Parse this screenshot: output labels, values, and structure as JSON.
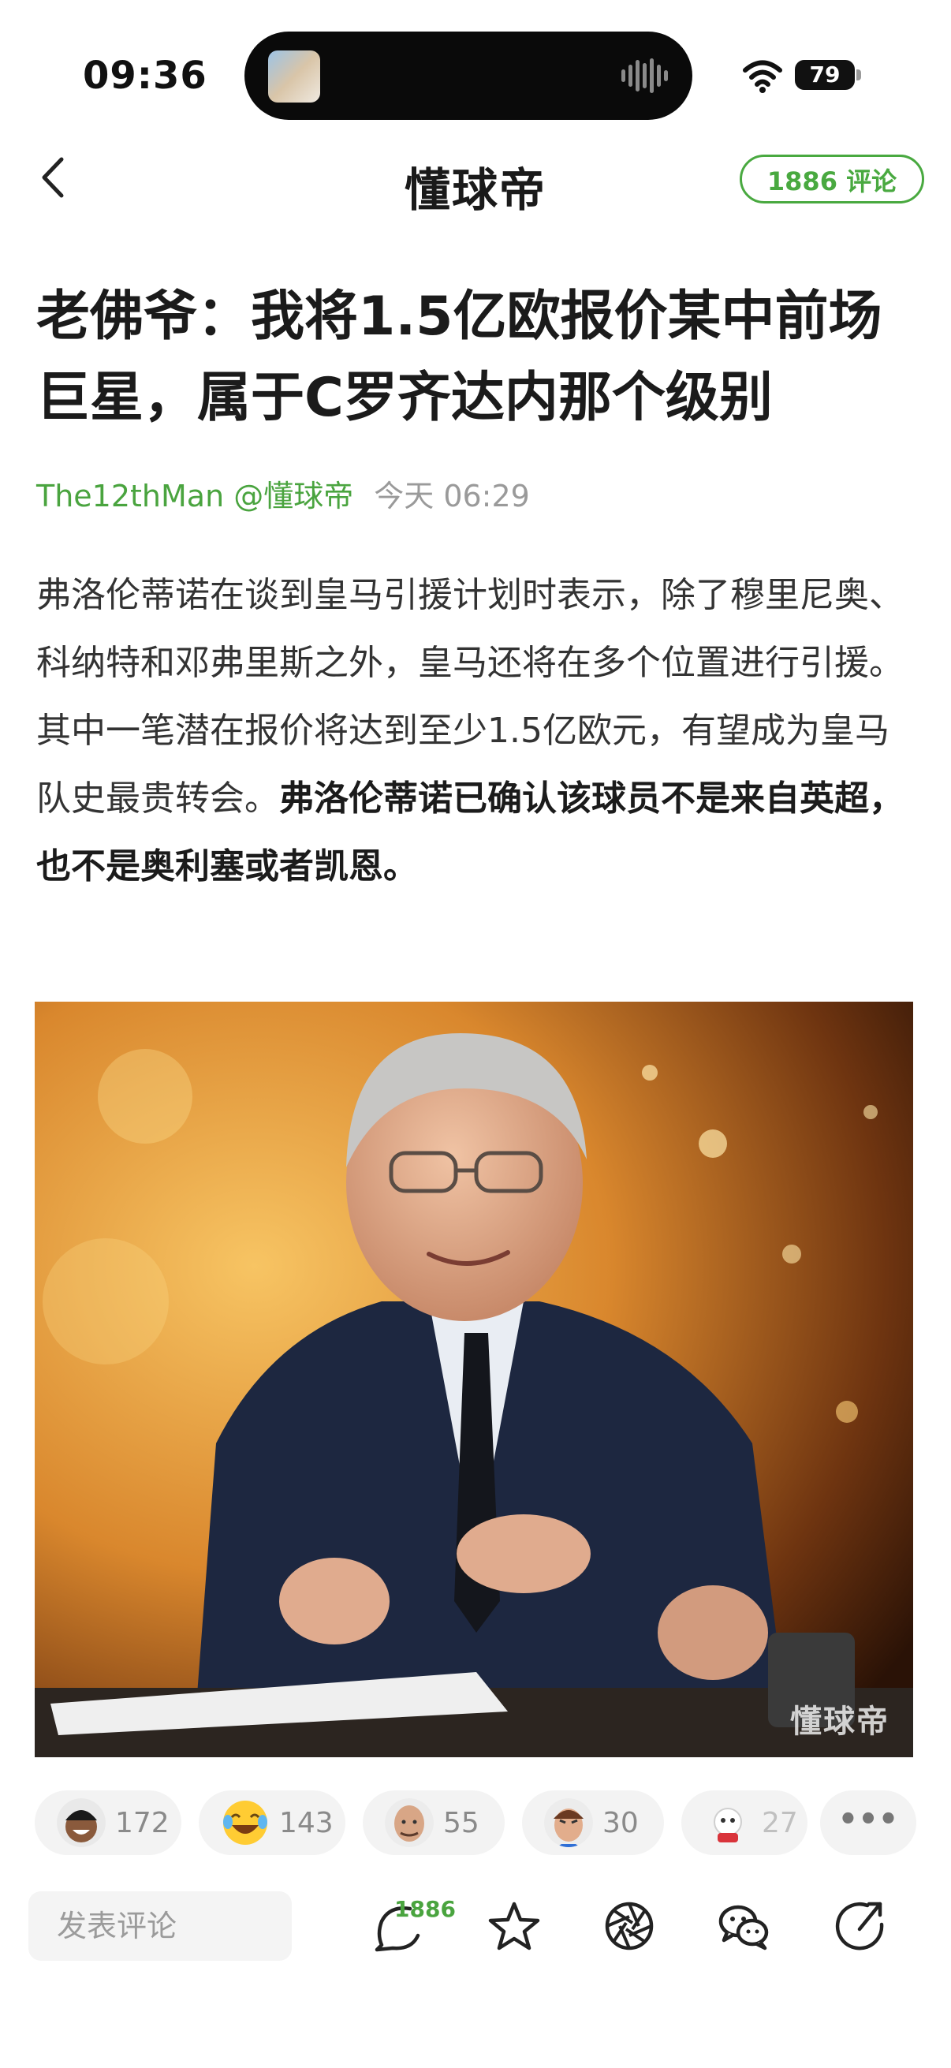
{
  "status_bar": {
    "time": "09:36",
    "battery": "79"
  },
  "nav": {
    "logo": "懂球帝",
    "comments_button": "1886 评论"
  },
  "article": {
    "title": "老佛爷：我将1.5亿欧报价某中前场巨星，属于C罗齐达内那个级别",
    "author": "The12thMan @懂球帝",
    "date": "今天 06:29",
    "body_normal": "弗洛伦蒂诺在谈到皇马引援计划时表示，除了穆里尼奥、科纳特和邓弗里斯之外，皇马还将在多个位置进行引援。其中一笔潜在报价将达到至少1.5亿欧元，有望成为皇马队史最贵转会。",
    "body_bold": "弗洛伦蒂诺已确认该球员不是来自英超，也不是奥利塞或者凯恩。",
    "image_watermark": "懂球帝"
  },
  "reactions": [
    {
      "icon": "laughing-avatar-icon",
      "count": "172"
    },
    {
      "icon": "tears-of-joy-emoji-icon",
      "count": "143"
    },
    {
      "icon": "bald-man-avatar-icon",
      "count": "55"
    },
    {
      "icon": "angry-man-avatar-icon",
      "count": "30"
    },
    {
      "icon": "mascot-avatar-icon",
      "count": "27"
    }
  ],
  "bottom_bar": {
    "comment_placeholder": "发表评论",
    "comment_count": "1886"
  },
  "colors": {
    "accent_green": "#4aa43f",
    "text": "#1b1b1b",
    "muted": "#9a9a9a"
  }
}
